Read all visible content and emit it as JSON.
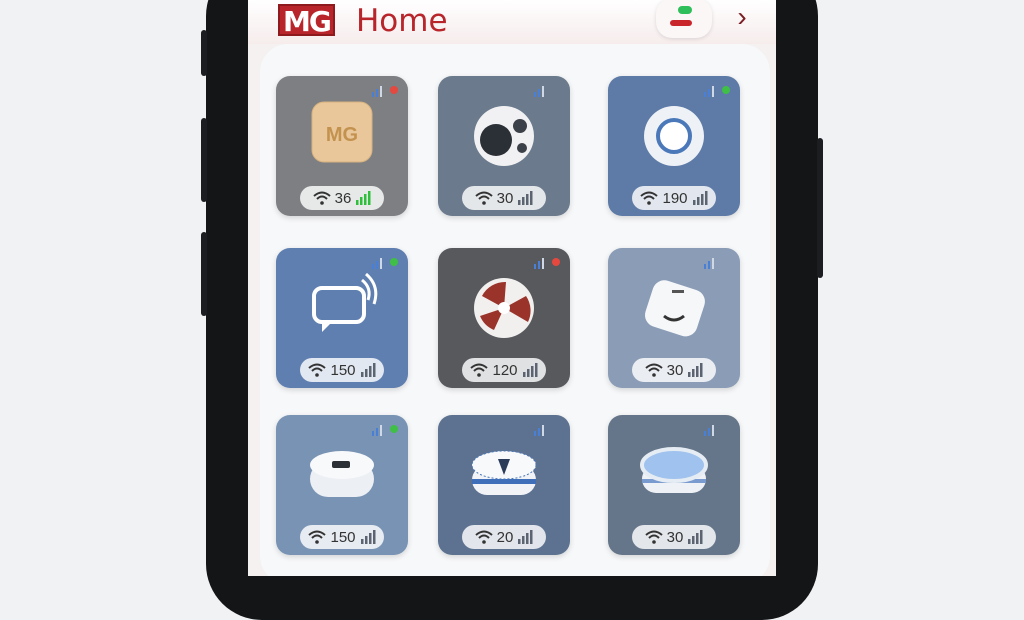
{
  "app": {
    "logo_text": "MG",
    "title": "Home",
    "status_indicator": "status-toggle",
    "nav": "chevron-right-icon"
  },
  "devices": [
    {
      "name": "mg-hub",
      "value": "36",
      "bg": "#7d7f82",
      "status": "red",
      "status_color": "#e5483f",
      "signal_color": "#2fbf3a",
      "icon": "mg-hub-icon"
    },
    {
      "name": "speaker-sphere",
      "value": "30",
      "bg": "#6b7a8c",
      "status": "none",
      "signal_color": "#5b6470",
      "icon": "speaker-icon"
    },
    {
      "name": "round-sensor",
      "value": "190",
      "bg": "#5d7ba6",
      "status": "green",
      "status_color": "#3fbf45",
      "signal_color": "#5b6470",
      "icon": "sensor-icon"
    },
    {
      "name": "chat-device",
      "value": "150",
      "bg": "#5f7fb0",
      "status": "green",
      "status_color": "#3fbf45",
      "signal_color": "#5b6470",
      "icon": "chat-icon"
    },
    {
      "name": "fan-device",
      "value": "120",
      "bg": "#57595d",
      "status": "red",
      "status_color": "#e5483f",
      "signal_color": "#5b6470",
      "icon": "fan-icon"
    },
    {
      "name": "tag-device",
      "value": "30",
      "bg": "#8a9cb6",
      "status": "none",
      "signal_color": "#5b6470",
      "icon": "tag-icon"
    },
    {
      "name": "puck-device",
      "value": "150",
      "bg": "#7893b4",
      "status": "green",
      "status_color": "#3fbf45",
      "signal_color": "#5b6470",
      "icon": "puck-icon"
    },
    {
      "name": "vacuum-device",
      "value": "20",
      "bg": "#5d7290",
      "status": "none",
      "signal_color": "#5b6470",
      "icon": "vacuum-icon"
    },
    {
      "name": "disc-device",
      "value": "30",
      "bg": "#66768a",
      "status": "none",
      "signal_color": "#5b6470",
      "icon": "disc-icon"
    }
  ]
}
